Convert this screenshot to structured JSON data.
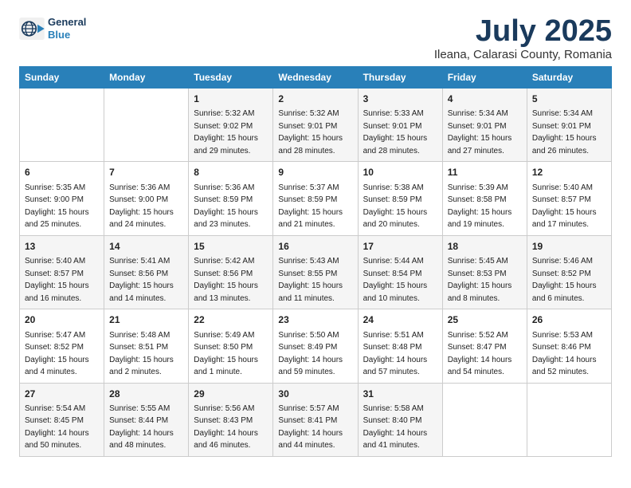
{
  "logo": {
    "general": "General",
    "blue": "Blue"
  },
  "title": "July 2025",
  "subtitle": "Ileana, Calarasi County, Romania",
  "weekdays": [
    "Sunday",
    "Monday",
    "Tuesday",
    "Wednesday",
    "Thursday",
    "Friday",
    "Saturday"
  ],
  "weeks": [
    [
      {
        "day": "",
        "info": ""
      },
      {
        "day": "",
        "info": ""
      },
      {
        "day": "1",
        "info": "Sunrise: 5:32 AM\nSunset: 9:02 PM\nDaylight: 15 hours and 29 minutes."
      },
      {
        "day": "2",
        "info": "Sunrise: 5:32 AM\nSunset: 9:01 PM\nDaylight: 15 hours and 28 minutes."
      },
      {
        "day": "3",
        "info": "Sunrise: 5:33 AM\nSunset: 9:01 PM\nDaylight: 15 hours and 28 minutes."
      },
      {
        "day": "4",
        "info": "Sunrise: 5:34 AM\nSunset: 9:01 PM\nDaylight: 15 hours and 27 minutes."
      },
      {
        "day": "5",
        "info": "Sunrise: 5:34 AM\nSunset: 9:01 PM\nDaylight: 15 hours and 26 minutes."
      }
    ],
    [
      {
        "day": "6",
        "info": "Sunrise: 5:35 AM\nSunset: 9:00 PM\nDaylight: 15 hours and 25 minutes."
      },
      {
        "day": "7",
        "info": "Sunrise: 5:36 AM\nSunset: 9:00 PM\nDaylight: 15 hours and 24 minutes."
      },
      {
        "day": "8",
        "info": "Sunrise: 5:36 AM\nSunset: 8:59 PM\nDaylight: 15 hours and 23 minutes."
      },
      {
        "day": "9",
        "info": "Sunrise: 5:37 AM\nSunset: 8:59 PM\nDaylight: 15 hours and 21 minutes."
      },
      {
        "day": "10",
        "info": "Sunrise: 5:38 AM\nSunset: 8:59 PM\nDaylight: 15 hours and 20 minutes."
      },
      {
        "day": "11",
        "info": "Sunrise: 5:39 AM\nSunset: 8:58 PM\nDaylight: 15 hours and 19 minutes."
      },
      {
        "day": "12",
        "info": "Sunrise: 5:40 AM\nSunset: 8:57 PM\nDaylight: 15 hours and 17 minutes."
      }
    ],
    [
      {
        "day": "13",
        "info": "Sunrise: 5:40 AM\nSunset: 8:57 PM\nDaylight: 15 hours and 16 minutes."
      },
      {
        "day": "14",
        "info": "Sunrise: 5:41 AM\nSunset: 8:56 PM\nDaylight: 15 hours and 14 minutes."
      },
      {
        "day": "15",
        "info": "Sunrise: 5:42 AM\nSunset: 8:56 PM\nDaylight: 15 hours and 13 minutes."
      },
      {
        "day": "16",
        "info": "Sunrise: 5:43 AM\nSunset: 8:55 PM\nDaylight: 15 hours and 11 minutes."
      },
      {
        "day": "17",
        "info": "Sunrise: 5:44 AM\nSunset: 8:54 PM\nDaylight: 15 hours and 10 minutes."
      },
      {
        "day": "18",
        "info": "Sunrise: 5:45 AM\nSunset: 8:53 PM\nDaylight: 15 hours and 8 minutes."
      },
      {
        "day": "19",
        "info": "Sunrise: 5:46 AM\nSunset: 8:52 PM\nDaylight: 15 hours and 6 minutes."
      }
    ],
    [
      {
        "day": "20",
        "info": "Sunrise: 5:47 AM\nSunset: 8:52 PM\nDaylight: 15 hours and 4 minutes."
      },
      {
        "day": "21",
        "info": "Sunrise: 5:48 AM\nSunset: 8:51 PM\nDaylight: 15 hours and 2 minutes."
      },
      {
        "day": "22",
        "info": "Sunrise: 5:49 AM\nSunset: 8:50 PM\nDaylight: 15 hours and 1 minute."
      },
      {
        "day": "23",
        "info": "Sunrise: 5:50 AM\nSunset: 8:49 PM\nDaylight: 14 hours and 59 minutes."
      },
      {
        "day": "24",
        "info": "Sunrise: 5:51 AM\nSunset: 8:48 PM\nDaylight: 14 hours and 57 minutes."
      },
      {
        "day": "25",
        "info": "Sunrise: 5:52 AM\nSunset: 8:47 PM\nDaylight: 14 hours and 54 minutes."
      },
      {
        "day": "26",
        "info": "Sunrise: 5:53 AM\nSunset: 8:46 PM\nDaylight: 14 hours and 52 minutes."
      }
    ],
    [
      {
        "day": "27",
        "info": "Sunrise: 5:54 AM\nSunset: 8:45 PM\nDaylight: 14 hours and 50 minutes."
      },
      {
        "day": "28",
        "info": "Sunrise: 5:55 AM\nSunset: 8:44 PM\nDaylight: 14 hours and 48 minutes."
      },
      {
        "day": "29",
        "info": "Sunrise: 5:56 AM\nSunset: 8:43 PM\nDaylight: 14 hours and 46 minutes."
      },
      {
        "day": "30",
        "info": "Sunrise: 5:57 AM\nSunset: 8:41 PM\nDaylight: 14 hours and 44 minutes."
      },
      {
        "day": "31",
        "info": "Sunrise: 5:58 AM\nSunset: 8:40 PM\nDaylight: 14 hours and 41 minutes."
      },
      {
        "day": "",
        "info": ""
      },
      {
        "day": "",
        "info": ""
      }
    ]
  ]
}
